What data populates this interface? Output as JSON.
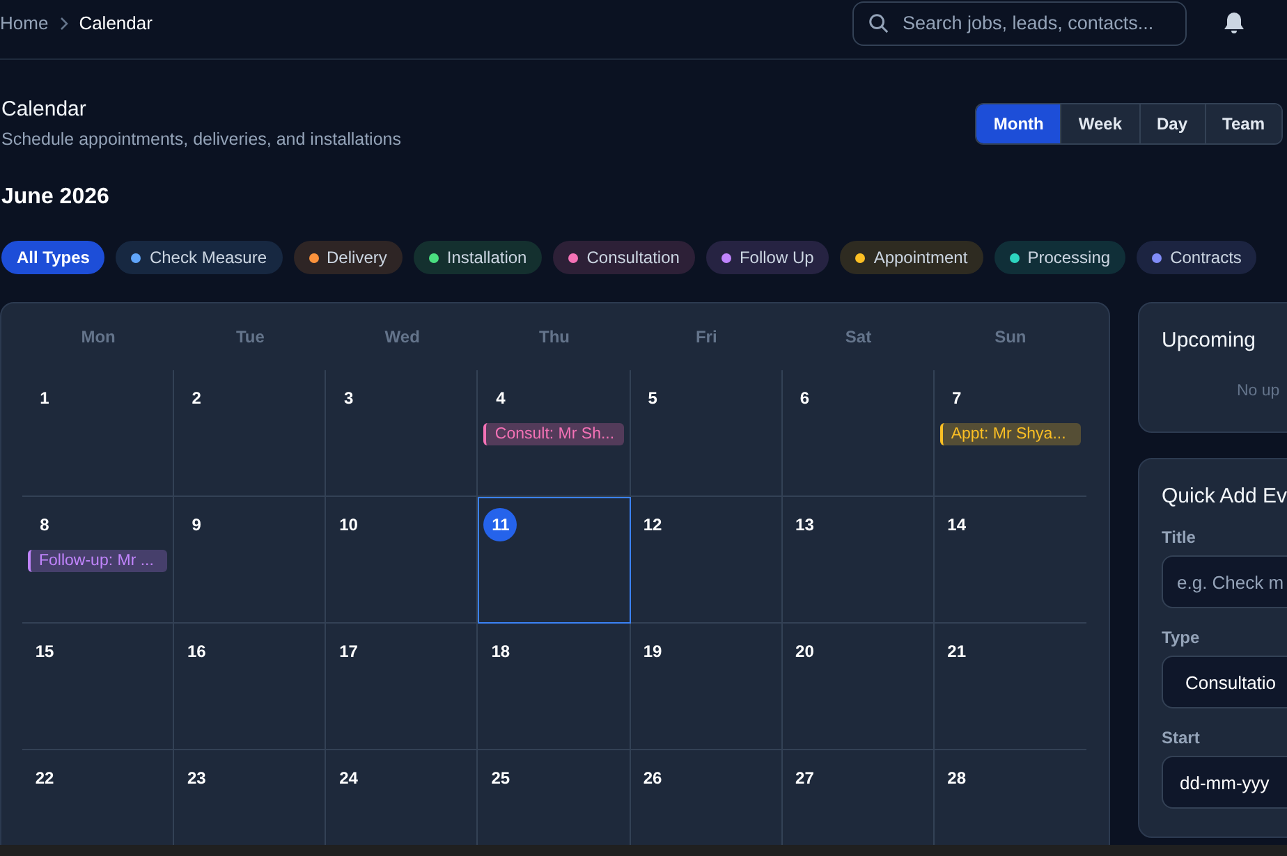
{
  "breadcrumb": [
    {
      "label": "Home",
      "current": false
    },
    {
      "label": "Calendar",
      "current": true
    }
  ],
  "search": {
    "placeholder": "Search jobs, leads, contacts..."
  },
  "page": {
    "title": "Calendar",
    "subtitle": "Schedule appointments, deliveries, and installations"
  },
  "views": [
    {
      "label": "Month",
      "selected": true
    },
    {
      "label": "Week",
      "selected": false
    },
    {
      "label": "Day",
      "selected": false
    },
    {
      "label": "Team",
      "selected": false
    }
  ],
  "month_title": "June 2026",
  "filters": [
    {
      "label": "All Types",
      "selected": true
    },
    {
      "label": "Check Measure",
      "selected": false,
      "color": "#60a5fa"
    },
    {
      "label": "Delivery",
      "selected": false,
      "color": "#fb923c"
    },
    {
      "label": "Installation",
      "selected": false,
      "color": "#4ade80"
    },
    {
      "label": "Consultation",
      "selected": false,
      "color": "#f472b6"
    },
    {
      "label": "Follow Up",
      "selected": false,
      "color": "#c084fc"
    },
    {
      "label": "Appointment",
      "selected": false,
      "color": "#fbbf24"
    },
    {
      "label": "Processing",
      "selected": false,
      "color": "#2dd4bf"
    },
    {
      "label": "Contracts",
      "selected": false,
      "color": "#818cf8"
    }
  ],
  "weekdays": [
    "Mon",
    "Tue",
    "Wed",
    "Thu",
    "Fri",
    "Sat",
    "Sun"
  ],
  "weeks": [
    [
      {
        "day": "1",
        "today": false
      },
      {
        "day": "2",
        "today": false
      },
      {
        "day": "3",
        "today": false
      },
      {
        "day": "4",
        "today": false,
        "events": [
          {
            "label": "Consult: Mr Sh...",
            "color": "#f472b6"
          }
        ]
      },
      {
        "day": "5",
        "today": false
      },
      {
        "day": "6",
        "today": false
      },
      {
        "day": "7",
        "today": false,
        "events": [
          {
            "label": "Appt: Mr Shya...",
            "color": "#fbbf24"
          }
        ]
      }
    ],
    [
      {
        "day": "8",
        "today": false,
        "events": [
          {
            "label": "Follow-up: Mr ...",
            "color": "#c084fc"
          }
        ]
      },
      {
        "day": "9",
        "today": false
      },
      {
        "day": "10",
        "today": false
      },
      {
        "day": "11",
        "today": true
      },
      {
        "day": "12",
        "today": false
      },
      {
        "day": "13",
        "today": false
      },
      {
        "day": "14",
        "today": false
      }
    ],
    [
      {
        "day": "15",
        "today": false
      },
      {
        "day": "16",
        "today": false
      },
      {
        "day": "17",
        "today": false
      },
      {
        "day": "18",
        "today": false
      },
      {
        "day": "19",
        "today": false
      },
      {
        "day": "20",
        "today": false
      },
      {
        "day": "21",
        "today": false
      }
    ],
    [
      {
        "day": "22",
        "today": false
      },
      {
        "day": "23",
        "today": false
      },
      {
        "day": "24",
        "today": false
      },
      {
        "day": "25",
        "today": false
      },
      {
        "day": "26",
        "today": false
      },
      {
        "day": "27",
        "today": false
      },
      {
        "day": "28",
        "today": false
      }
    ]
  ],
  "upcoming": {
    "title": "Upcoming",
    "empty_text": "No up"
  },
  "quick_add": {
    "title": "Quick Add Ev",
    "fields": [
      {
        "label": "Title",
        "kind": "text",
        "placeholder": "e.g. Check m"
      },
      {
        "label": "Type",
        "kind": "select",
        "value": "Consultatio"
      },
      {
        "label": "Start",
        "kind": "date",
        "value": "dd-mm-yyy"
      }
    ]
  }
}
